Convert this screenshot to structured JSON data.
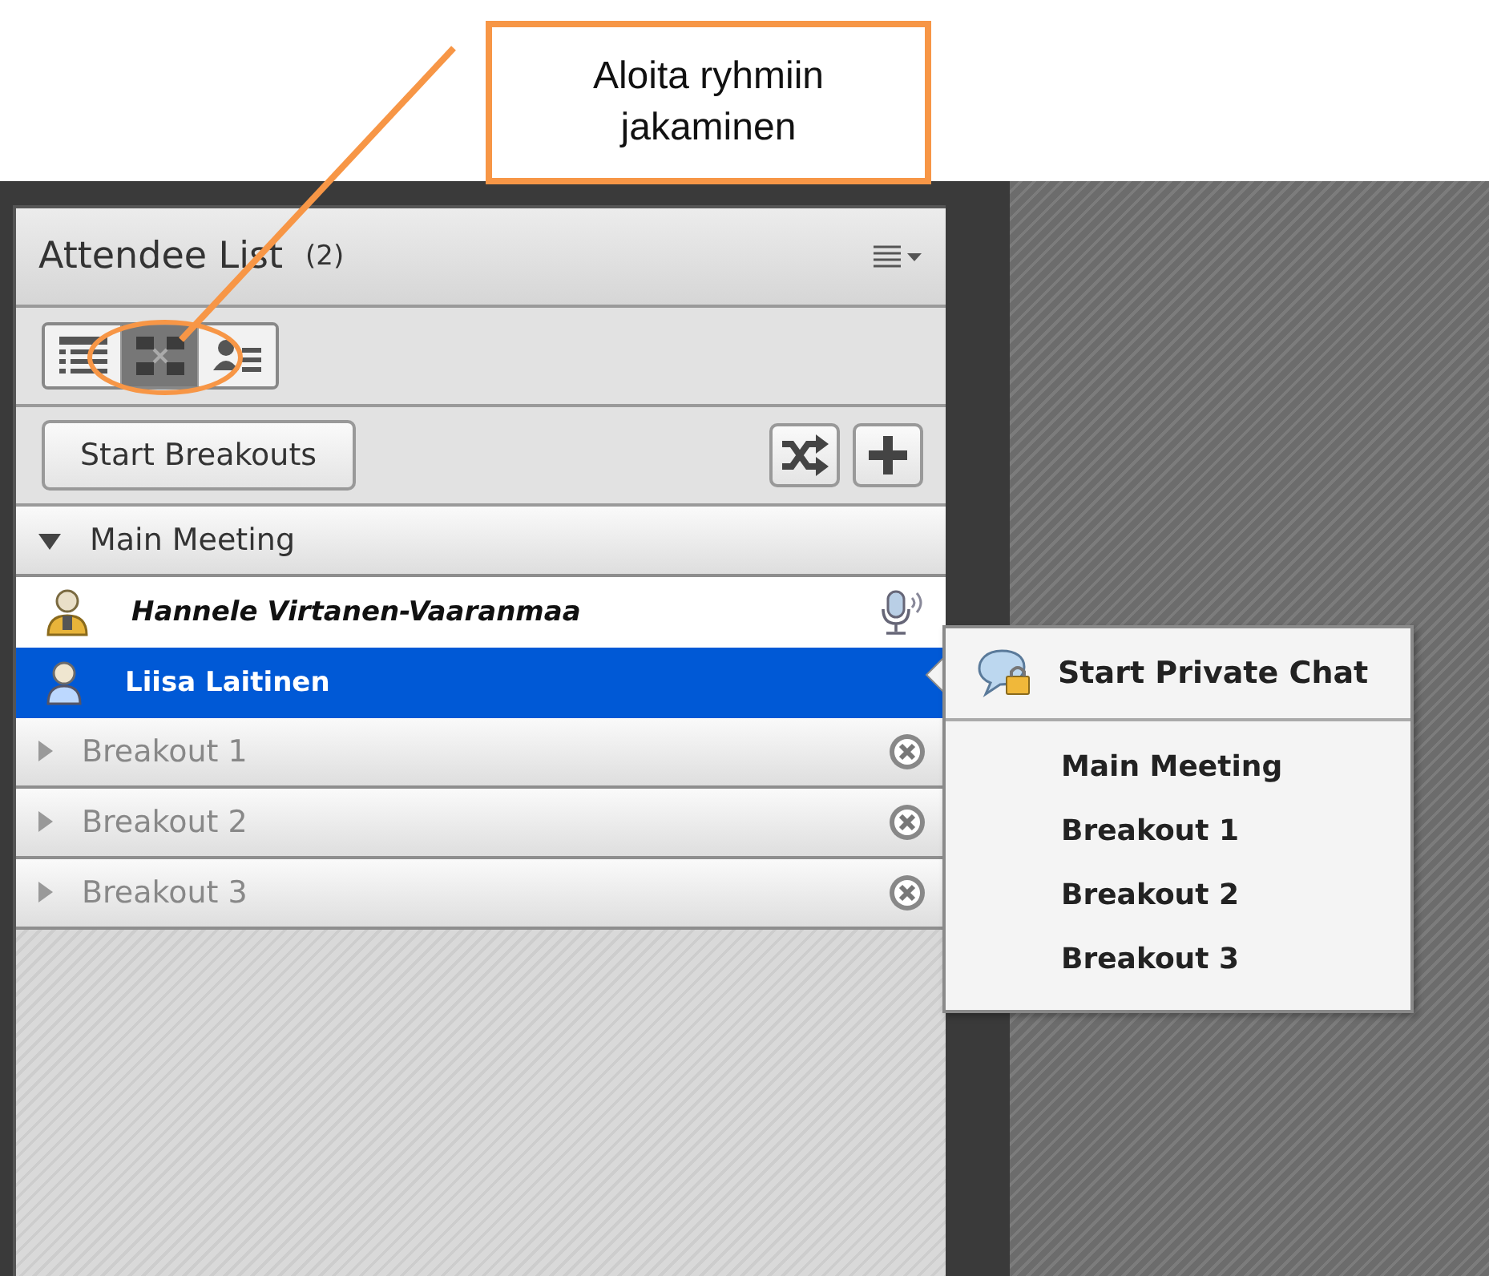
{
  "callout": {
    "lines": [
      "Aloita ryhmiin",
      "jakaminen"
    ]
  },
  "panel": {
    "title": "Attendee List",
    "count": "(2)",
    "view_buttons": [
      {
        "kind": "list",
        "selected": false
      },
      {
        "kind": "breakout",
        "selected": true
      },
      {
        "kind": "presenter",
        "selected": false
      }
    ],
    "start_button": "Start Breakouts",
    "groups": [
      {
        "name": "Main Meeting",
        "expanded": true,
        "removable": false,
        "attendees": [
          {
            "name": "Hannele Virtanen-Vaaranmaa",
            "kind": "host",
            "selected": false,
            "speaking": true
          },
          {
            "name": "Liisa Laitinen",
            "kind": "participant",
            "selected": true,
            "speaking": false
          }
        ]
      },
      {
        "name": "Breakout 1",
        "expanded": false,
        "removable": true
      },
      {
        "name": "Breakout 2",
        "expanded": false,
        "removable": true
      },
      {
        "name": "Breakout 3",
        "expanded": false,
        "removable": true
      }
    ]
  },
  "context_menu": {
    "items": [
      {
        "kind": "chat",
        "label": "Start Private Chat"
      },
      {
        "kind": "move",
        "label": "Main Meeting"
      },
      {
        "kind": "move",
        "label": "Breakout 1"
      },
      {
        "kind": "move",
        "label": "Breakout 2"
      },
      {
        "kind": "move",
        "label": "Breakout 3"
      }
    ]
  }
}
